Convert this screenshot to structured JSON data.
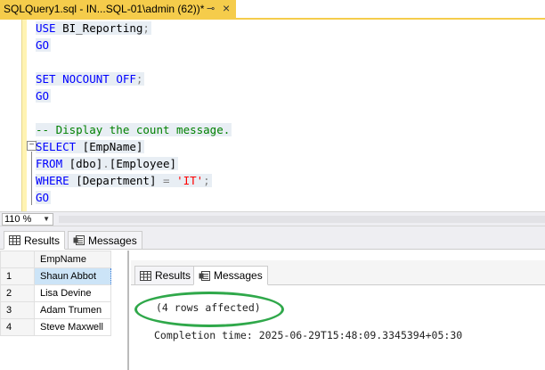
{
  "tab": {
    "title": "SQLQuery1.sql - IN...SQL-01\\admin (62))*",
    "pin_glyph": "⊸",
    "close_glyph": "×"
  },
  "editor": {
    "lines": [
      {
        "parts": [
          {
            "t": "USE",
            "c": "kw"
          },
          {
            "t": " BI_Reporting",
            "c": "id"
          },
          {
            "t": ";",
            "c": "op"
          }
        ],
        "hl": true
      },
      {
        "parts": [
          {
            "t": "GO",
            "c": "kw"
          }
        ],
        "hl": true
      },
      {
        "parts": [],
        "hl": false
      },
      {
        "parts": [
          {
            "t": "SET",
            "c": "kw"
          },
          {
            "t": " ",
            "c": "id"
          },
          {
            "t": "NOCOUNT",
            "c": "kw"
          },
          {
            "t": " ",
            "c": "id"
          },
          {
            "t": "OFF",
            "c": "kw"
          },
          {
            "t": ";",
            "c": "op"
          }
        ],
        "hl": true
      },
      {
        "parts": [
          {
            "t": "GO",
            "c": "kw"
          }
        ],
        "hl": true
      },
      {
        "parts": [],
        "hl": false
      },
      {
        "parts": [
          {
            "t": "-- Display the count message.",
            "c": "cm"
          }
        ],
        "hl": true
      },
      {
        "parts": [
          {
            "t": "SELECT",
            "c": "kw"
          },
          {
            "t": " [EmpName]",
            "c": "id"
          }
        ],
        "hl": true
      },
      {
        "parts": [
          {
            "t": "FROM",
            "c": "kw"
          },
          {
            "t": " [dbo]",
            "c": "id"
          },
          {
            "t": ".",
            "c": "op"
          },
          {
            "t": "[Employee]",
            "c": "id"
          }
        ],
        "hl": true
      },
      {
        "parts": [
          {
            "t": "WHERE",
            "c": "kw"
          },
          {
            "t": " [Department] ",
            "c": "id"
          },
          {
            "t": "=",
            "c": "op"
          },
          {
            "t": " ",
            "c": "id"
          },
          {
            "t": "'IT'",
            "c": "str"
          },
          {
            "t": ";",
            "c": "op"
          }
        ],
        "hl": true
      },
      {
        "parts": [
          {
            "t": "GO",
            "c": "kw"
          }
        ],
        "hl": true
      }
    ]
  },
  "zoom": {
    "value": "110 %"
  },
  "results_tabs": {
    "results": "Results",
    "messages": "Messages"
  },
  "grid": {
    "column": "EmpName",
    "rows": [
      {
        "num": "1",
        "value": "Shaun Abbot"
      },
      {
        "num": "2",
        "value": "Lisa Devine"
      },
      {
        "num": "3",
        "value": "Adam Trumen"
      },
      {
        "num": "4",
        "value": "Steve Maxwell"
      }
    ]
  },
  "inner": {
    "tabs": {
      "results": "Results",
      "messages": "Messages"
    },
    "rows_affected": "(4 rows affected)",
    "completion": "Completion time: 2025-06-29T15:48:09.3345394+05:30",
    "highlight_color": "#2fa84a"
  }
}
